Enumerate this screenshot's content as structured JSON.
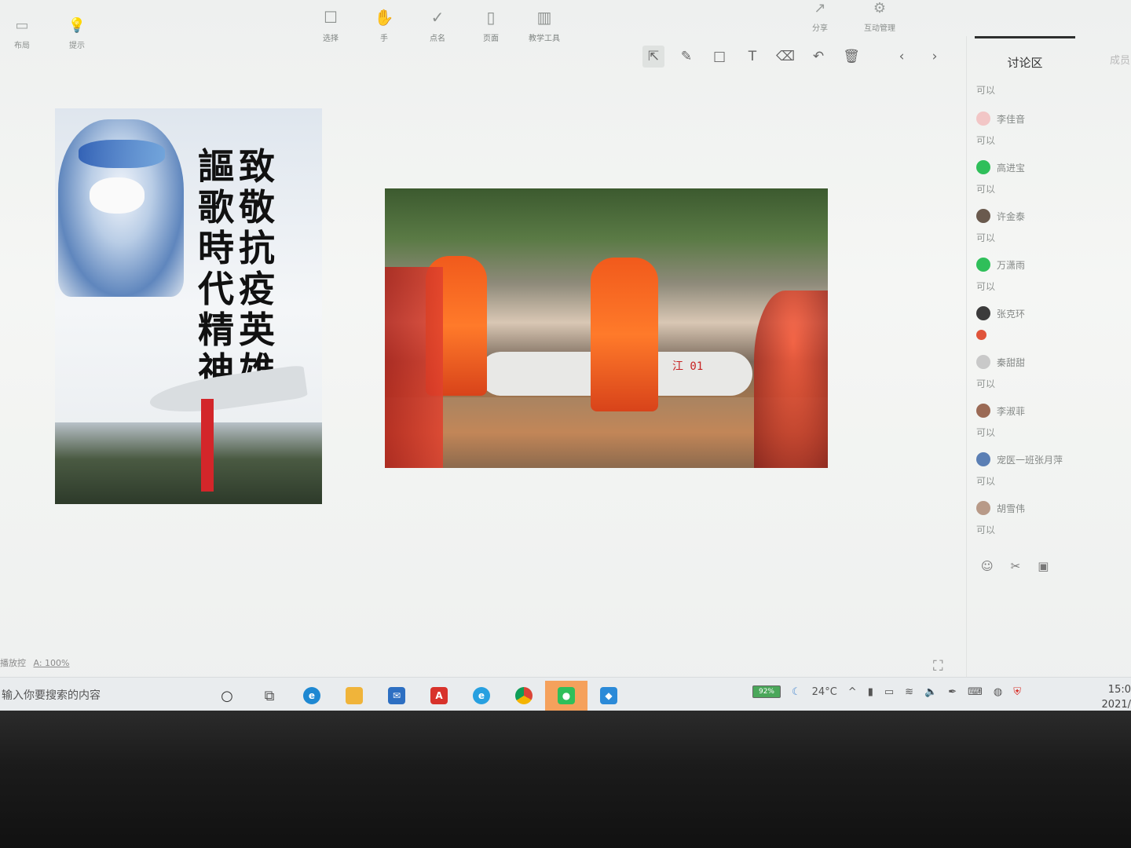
{
  "top_left_tools": [
    {
      "icon": "layout-icon",
      "label": "布局"
    },
    {
      "icon": "bulb-icon",
      "label": "提示"
    }
  ],
  "main_tools": [
    {
      "icon": "select-icon",
      "label": "选择"
    },
    {
      "icon": "hand-icon",
      "label": "手"
    },
    {
      "icon": "check-icon",
      "label": "点名"
    },
    {
      "icon": "page-icon",
      "label": "页面"
    },
    {
      "icon": "chart-icon",
      "label": "教学工具"
    }
  ],
  "right_tools": [
    {
      "icon": "share-icon",
      "label": "分享"
    },
    {
      "icon": "settings-icon",
      "label": "互动管理"
    }
  ],
  "draw_tools": [
    {
      "name": "pointer",
      "glyph": "⇱"
    },
    {
      "name": "pen",
      "glyph": "✎"
    },
    {
      "name": "rectangle",
      "glyph": "□"
    },
    {
      "name": "text",
      "glyph": "T"
    },
    {
      "name": "eraser",
      "glyph": "⌫"
    },
    {
      "name": "undo",
      "glyph": "↶"
    },
    {
      "name": "delete",
      "glyph": "🗑"
    },
    {
      "name": "prev",
      "glyph": "‹"
    },
    {
      "name": "next",
      "glyph": "›"
    }
  ],
  "poster": {
    "col_right": [
      "致",
      "敬",
      "抗",
      "疫",
      "英",
      "雄"
    ],
    "col_left": [
      "謳",
      "歌",
      "時",
      "代",
      "精",
      "神"
    ]
  },
  "photo": {
    "boat_label": "江 01"
  },
  "panel": {
    "active_tab": "讨论区",
    "other_tab": "成员",
    "top_message": "可以",
    "messages": [
      {
        "name": "李佳音",
        "text": "可以",
        "avatar_color": "#f2c6c6"
      },
      {
        "name": "高进宝",
        "text": "可以",
        "avatar_color": "#2fbf5a"
      },
      {
        "name": "许金泰",
        "text": "可以",
        "avatar_color": "#6a5a4e"
      },
      {
        "name": "万潇雨",
        "text": "可以",
        "avatar_color": "#2fbf5a"
      },
      {
        "name": "张克环",
        "text": "",
        "avatar_color": "#3b3b3b"
      },
      {
        "name": "秦甜甜",
        "text": "可以",
        "avatar_color": "#c9c9c9"
      },
      {
        "name": "李淑菲",
        "text": "可以",
        "avatar_color": "#9b6a55"
      },
      {
        "name": "宠医一班张月萍",
        "text": "可以",
        "avatar_color": "#5b7fb4"
      },
      {
        "name": "胡雪伟",
        "text": "可以",
        "avatar_color": "#b89a88"
      }
    ]
  },
  "status": {
    "left_label": "播放控",
    "zoom": "A: 100%"
  },
  "taskbar": {
    "search_text": "输入你要搜索的内容",
    "battery": "92%",
    "weather": "24°C",
    "time": "15:0",
    "date": "2021/"
  }
}
